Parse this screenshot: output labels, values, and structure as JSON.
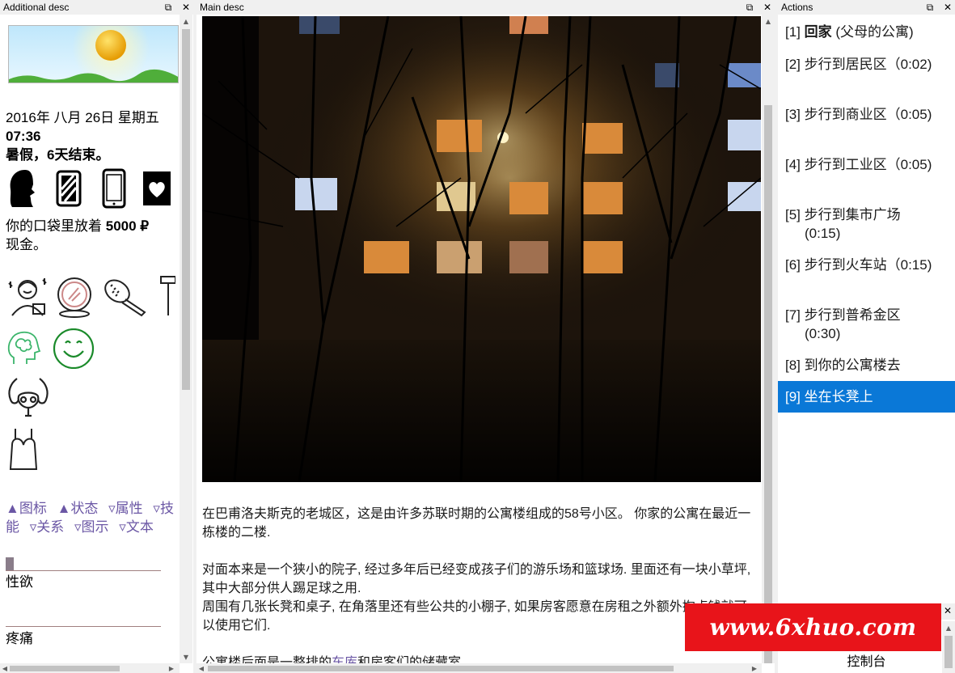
{
  "left_panel": {
    "title": "Additional desc",
    "date": "2016年 八月 26日 星期五",
    "time": "07:36",
    "holiday": "暑假，6天结束。",
    "money_prefix": "你的口袋里放着",
    "money_amount": "5000 ₽",
    "money_suffix": "现金。",
    "tabs": [
      "▲图标",
      "▲状态",
      "▿属性",
      "▿技能",
      "▿关系",
      "▿图示",
      "▿文本"
    ],
    "stats": [
      {
        "label": "性欲",
        "level": 0.04
      },
      {
        "label": "疼痛",
        "level": 0
      }
    ],
    "icons": [
      "sun-weather-icon",
      "woman-head-icon",
      "striped-card-icon",
      "phone-icon",
      "heart-book-icon",
      "face-cream-icon",
      "mirror-icon",
      "hairbrush-icon",
      "razor-icon",
      "brain-icon",
      "smile-icon",
      "uterus-icon",
      "bra-top-icon"
    ]
  },
  "middle_panel": {
    "title": "Main desc",
    "paragraphs": [
      "在巴甫洛夫斯克的老城区，这是由许多苏联时期的公寓楼组成的58号小区。 你家的公寓在最近一栋楼的二楼.",
      "对面本来是一个狭小的院子, 经过多年后已经变成孩子们的游乐场和篮球场. 里面还有一块小草坪, 其中大部分供人踢足球之用.",
      "周围有几张长凳和桌子, 在角落里还有些公共的小棚子, 如果房客愿意在房租之外额外掏点钱就可以使用它们."
    ],
    "last_line_prefix": "公寓楼后面是一整排的",
    "last_line_link": "车库",
    "last_line_suffix": "和房客们的储藏室."
  },
  "right_panel": {
    "title": "Actions",
    "actions": [
      {
        "num": "[1]",
        "bold": "回家",
        "text": " (父母的公寓)"
      },
      {
        "num": "[2]",
        "bold": "",
        "text": " 步行到居民区（0:02)"
      },
      {
        "num": "[3]",
        "bold": "",
        "text": " 步行到商业区（0:05)"
      },
      {
        "num": "[4]",
        "bold": "",
        "text": " 步行到工业区（0:05)"
      },
      {
        "num": "[5]",
        "bold": "",
        "text": " 步行到集市广场",
        "line2": "(0:15)"
      },
      {
        "num": "[6]",
        "bold": "",
        "text": " 步行到火车站（0:15)"
      },
      {
        "num": "[7]",
        "bold": "",
        "text": " 步行到普希金区",
        "line2": "(0:30)"
      },
      {
        "num": "[8]",
        "bold": "",
        "text": " 到你的公寓楼去"
      },
      {
        "num": "[9]",
        "bold": "",
        "text": " 坐在长凳上"
      }
    ]
  },
  "console": {
    "label": "控制台"
  },
  "watermark": "www.6xhuo.com",
  "colors": {
    "selected": "#0a78d7",
    "link": "#6b57a5",
    "watermark": "#e8141a"
  }
}
